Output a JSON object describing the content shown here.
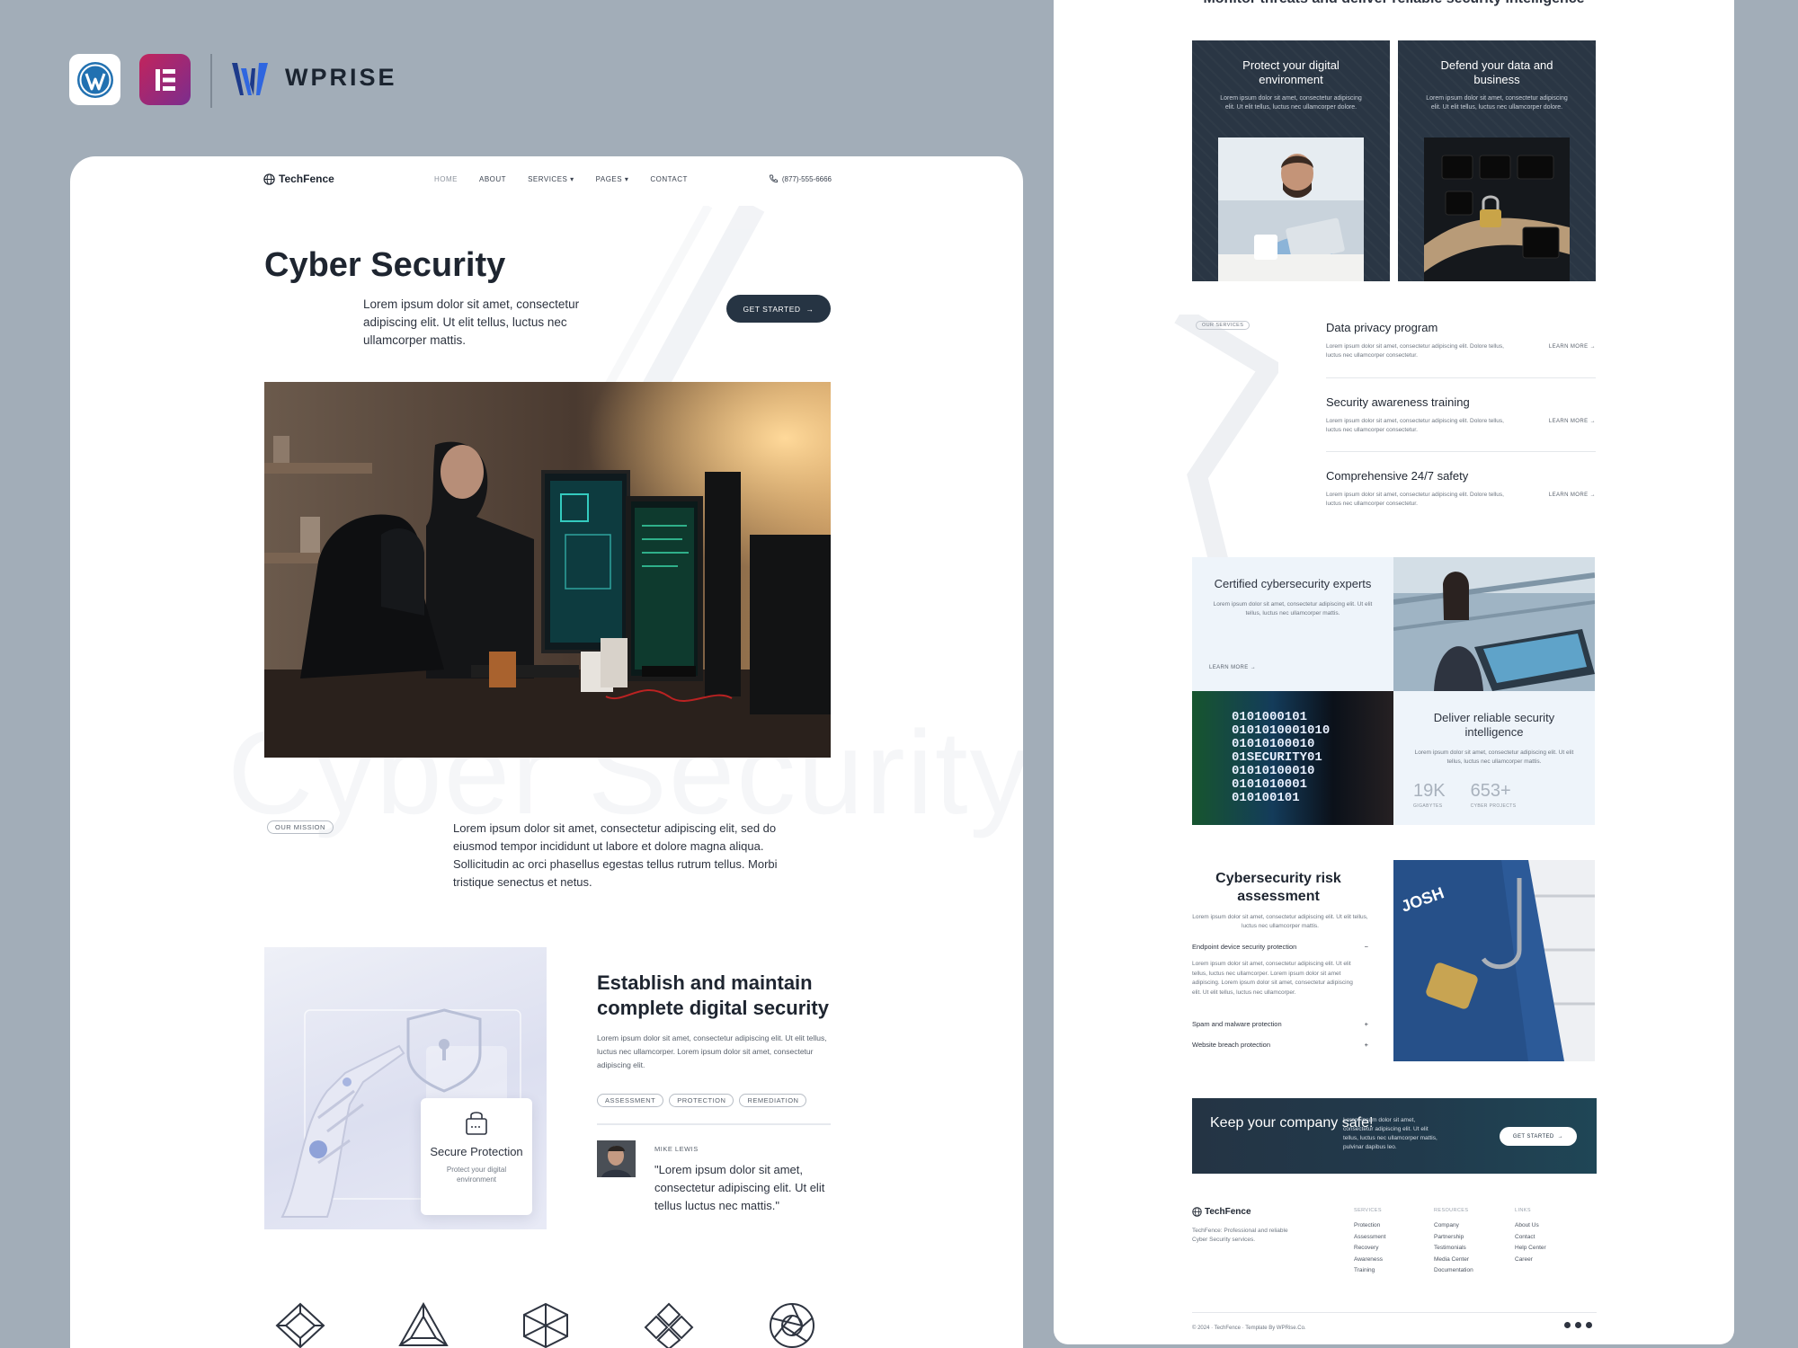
{
  "branding": {
    "wordpress_icon": "wordpress-icon",
    "elementor_icon": "elementor-icon",
    "wprise_name": "WPRISE"
  },
  "left": {
    "nav": {
      "brand": "TechFence",
      "links": [
        "HOME",
        "ABOUT",
        "SERVICES",
        "PAGES",
        "CONTACT"
      ],
      "phone": "(877)-555-6666"
    },
    "hero": {
      "title": "Cyber Security",
      "text": "Lorem ipsum dolor sit amet, consectetur adipiscing elit. Ut elit tellus, luctus nec ullamcorper mattis.",
      "button": "GET STARTED",
      "watermark": "Cyber Security"
    },
    "mission": {
      "badge": "OUR MISSION",
      "text": "Lorem ipsum dolor sit amet, consectetur adipiscing elit, sed do eiusmod tempor incididunt ut labore et dolore magna aliqua. Sollicitudin ac orci phasellus egestas tellus rutrum tellus. Morbi tristique senectus et netus."
    },
    "secure": {
      "title": "Secure Protection",
      "text": "Protect your digital environment"
    },
    "establish": {
      "title": "Establish and maintain complete digital security",
      "text": "Lorem ipsum dolor sit amet, consectetur adipiscing elit. Ut elit tellus, luctus nec ullamcorper. Lorem ipsum dolor sit amet, consectetur adipiscing elit.",
      "tags": [
        "ASSESSMENT",
        "PROTECTION",
        "REMEDIATION"
      ]
    },
    "testimonial": {
      "name": "MIKE LEWIS",
      "quote": "\"Lorem ipsum dolor sit amet, consectetur adipiscing elit. Ut elit tellus luctus nec mattis.\""
    },
    "partner_icons": [
      "diamond-logo-icon",
      "triangle-logo-icon",
      "hexagon-logo-icon",
      "knot-logo-icon",
      "aperture-logo-icon"
    ]
  },
  "right": {
    "heading": "Monitor threats and deliver reliable security intelligence",
    "cards": [
      {
        "title": "Protect your digital environment",
        "text": "Lorem ipsum dolor sit amet, consectetur adipiscing elit. Ut elit tellus, luctus nec ullamcorper dolore."
      },
      {
        "title": "Defend your data and business",
        "text": "Lorem ipsum dolor sit amet, consectetur adipiscing elit. Ut elit tellus, luctus nec ullamcorper dolore."
      }
    ],
    "services_badge": "OUR SERVICES",
    "services": [
      {
        "title": "Data privacy program",
        "text": "Lorem ipsum dolor sit amet, consectetur adipiscing elit. Dolore tellus, luctus nec ullamcorper consectetur.",
        "link": "LEARN MORE"
      },
      {
        "title": "Security awareness training",
        "text": "Lorem ipsum dolor sit amet, consectetur adipiscing elit. Dolore tellus, luctus nec ullamcorper consectetur.",
        "link": "LEARN MORE"
      },
      {
        "title": "Comprehensive 24/7 safety",
        "text": "Lorem ipsum dolor sit amet, consectetur adipiscing elit. Dolore tellus, luctus nec ullamcorper consectetur.",
        "link": "LEARN MORE"
      }
    ],
    "certified": {
      "title": "Certified cybersecurity experts",
      "text": "Lorem ipsum dolor sit amet, consectetur adipiscing elit. Ut elit tellus, luctus nec ullamcorper mattis.",
      "link": "LEARN MORE"
    },
    "binary_lines": [
      "0101000101",
      "0101010001010",
      "01010100010",
      "01SECURITY01",
      "01010100010",
      "0101010001",
      "010100101"
    ],
    "intelligence": {
      "title": "Deliver reliable security intelligence",
      "text": "Lorem ipsum dolor sit amet, consectetur adipiscing elit. Ut elit tellus, luctus nec ullamcorper mattis.",
      "stats": [
        {
          "value": "19K",
          "label": "GIGABYTES"
        },
        {
          "value": "653+",
          "label": "CYBER PROJECTS"
        }
      ]
    },
    "risk": {
      "title": "Cybersecurity risk assessment",
      "text": "Lorem ipsum dolor sit amet, consectetur adipiscing elit. Ut elit tellus, luctus nec ullamcorper mattis.",
      "accordion": [
        {
          "label": "Endpoint device security protection",
          "symbol": "−"
        },
        {
          "label": "Spam and malware protection",
          "symbol": "+"
        },
        {
          "label": "Website breach protection",
          "symbol": "+"
        }
      ],
      "accordion_body": "Lorem ipsum dolor sit amet, consectetur adipiscing elit. Ut elit tellus, luctus nec ullamcorper. Lorem ipsum dolor sit amet adipiscing. Lorem ipsum dolor sit amet, consectetur adipiscing elit. Ut elit tellus, luctus nec ullamcorper."
    },
    "card_text": "JOSH",
    "cta": {
      "title": "Keep your company safe!",
      "text": "Lorem ipsum dolor sit amet, consectetur adipiscing elit. Ut elit tellus, luctus nec ullamcorper mattis, pulvinar dapibus leo.",
      "button": "GET STARTED"
    },
    "footer": {
      "brand": "TechFence",
      "desc": "TechFence: Professional and reliable Cyber Security services.",
      "columns": [
        {
          "heading": "SERVICES",
          "items": [
            "Protection",
            "Assessment",
            "Recovery",
            "Awareness",
            "Training"
          ]
        },
        {
          "heading": "RESOURCES",
          "items": [
            "Company",
            "Partnership",
            "Testimonials",
            "Media Center",
            "Documentation"
          ]
        },
        {
          "heading": "LINKS",
          "items": [
            "About Us",
            "Contact",
            "Help Center",
            "Career"
          ]
        }
      ],
      "copyright": "© 2024 · TechFence · Template By WPRise.Co."
    }
  }
}
